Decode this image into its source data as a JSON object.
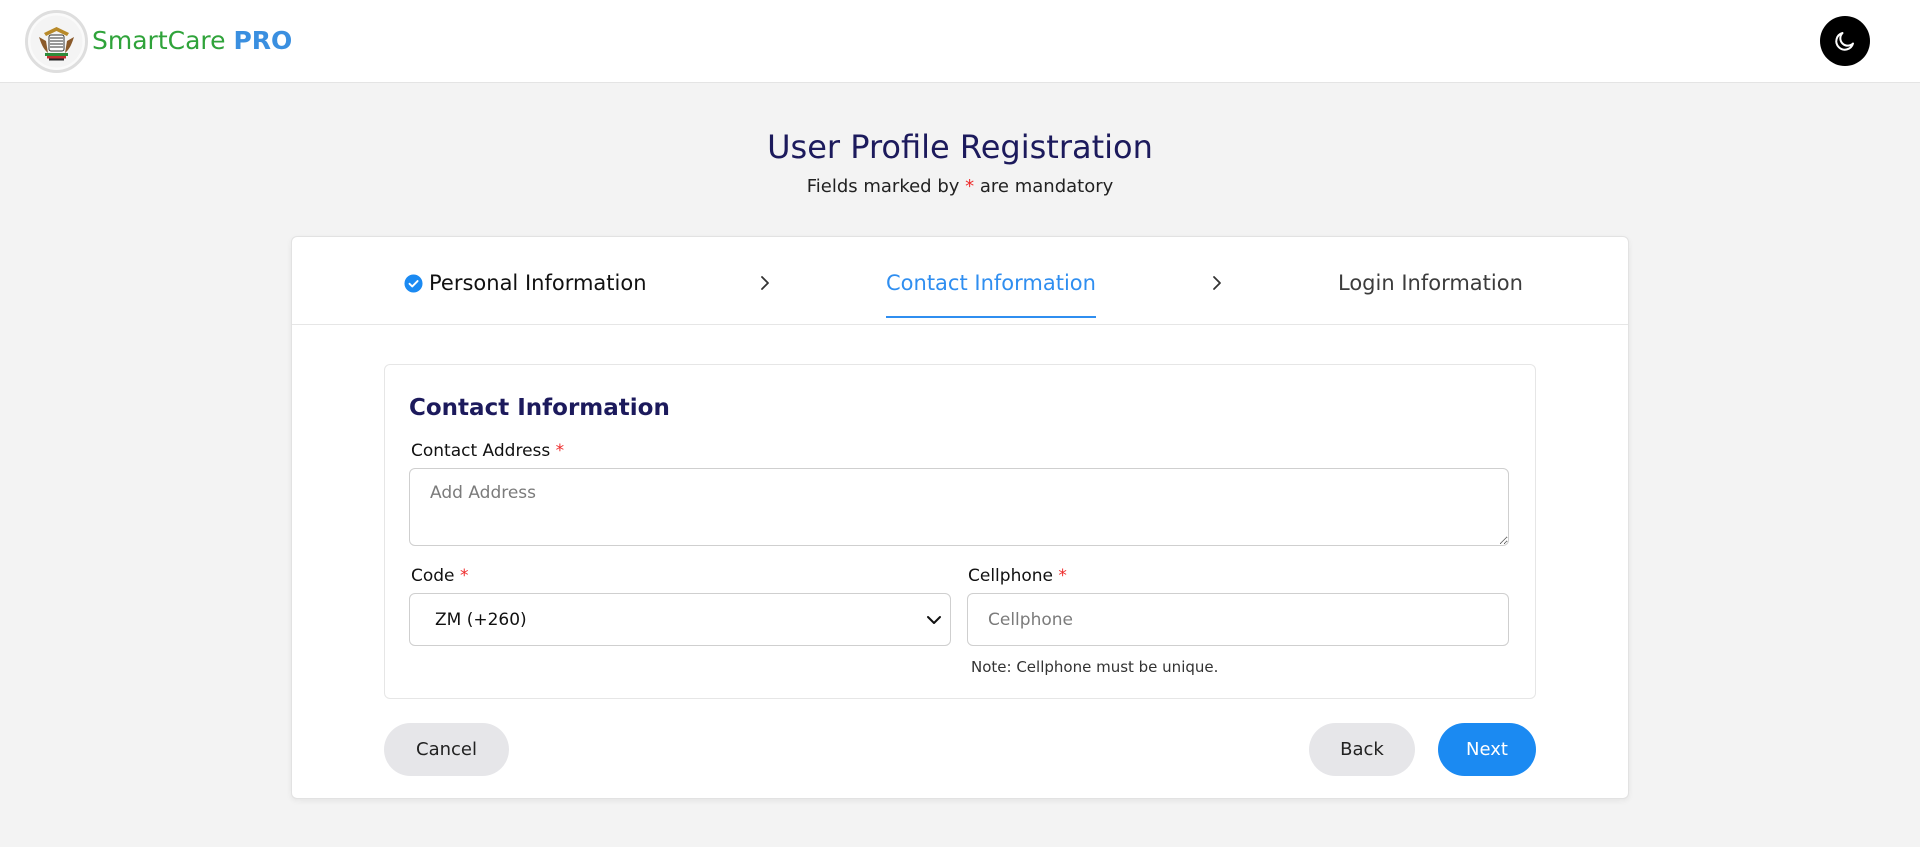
{
  "header": {
    "brand_part1": "SmartCare",
    "brand_part2": "PRO",
    "logo_icon": "coat-of-arms-icon",
    "theme_toggle_icon": "moon-icon"
  },
  "page": {
    "title": "User Profile Registration",
    "subtitle_before": "Fields marked by",
    "required_mark": "*",
    "subtitle_after": "are mandatory"
  },
  "steps": [
    {
      "label": "Personal Information",
      "status": "completed"
    },
    {
      "label": "Contact Information",
      "status": "active"
    },
    {
      "label": "Login Information",
      "status": "pending"
    }
  ],
  "form": {
    "section_title": "Contact Information",
    "contact_address_label": "Contact Address",
    "contact_address_placeholder": "Add Address",
    "contact_address_value": "",
    "code_label": "Code",
    "code_selected": "ZM (+260)",
    "cellphone_label": "Cellphone",
    "cellphone_placeholder": "Cellphone",
    "cellphone_value": "",
    "cellphone_note": "Note: Cellphone must be unique."
  },
  "buttons": {
    "cancel": "Cancel",
    "back": "Back",
    "next": "Next"
  },
  "colors": {
    "brand_green": "#2fa33a",
    "brand_blue": "#3a8fe0",
    "title_navy": "#1c1a5c",
    "accent_blue": "#1b8af2",
    "required_red": "#ee2a2a"
  }
}
